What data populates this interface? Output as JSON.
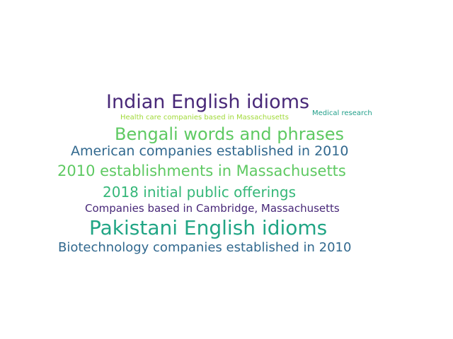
{
  "words": [
    {
      "text": "Indian English idioms",
      "color": "#482878"
    },
    {
      "text": "Health care companies based in Massachusetts",
      "color": "#a0da39"
    },
    {
      "text": "Medical research",
      "color": "#1f9e89"
    },
    {
      "text": "Bengali words and phrases",
      "color": "#5ec962"
    },
    {
      "text": "American companies established in 2010",
      "color": "#31688e"
    },
    {
      "text": "2010 establishments in Massachusetts",
      "color": "#5ec962"
    },
    {
      "text": "2018 initial public offerings",
      "color": "#35b779"
    },
    {
      "text": "Companies based in Cambridge, Massachusetts",
      "color": "#482878"
    },
    {
      "text": "Pakistani English idioms",
      "color": "#21a585"
    },
    {
      "text": "Biotechnology companies established in 2010",
      "color": "#31688e"
    }
  ]
}
